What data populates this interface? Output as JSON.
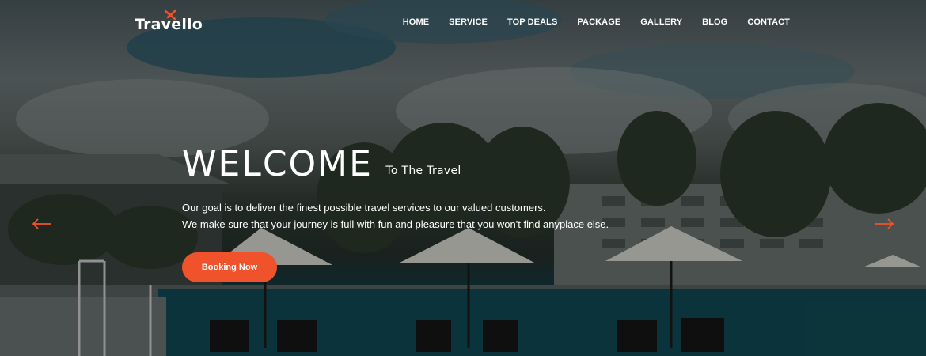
{
  "brand": {
    "name": "Travello",
    "accent_color": "#f0532b"
  },
  "nav": {
    "items": [
      "HOME",
      "SERVICE",
      "TOP DEALS",
      "PACKAGE",
      "GALLERY",
      "BLOG",
      "CONTACT"
    ]
  },
  "hero": {
    "title": "WELCOME",
    "subtitle": "To The Travel",
    "lines": [
      "Our goal is to deliver the finest possible travel services to our valued customers.",
      "We make sure that your journey is full with fun and pleasure that you won't find anyplace else."
    ],
    "cta_label": "Booking Now",
    "prev_icon": "arrow-left-icon",
    "next_icon": "arrow-right-icon"
  }
}
